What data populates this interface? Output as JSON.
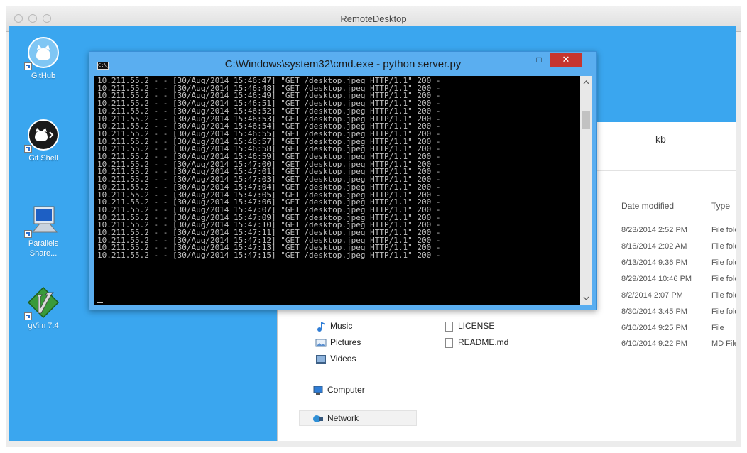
{
  "mac_window": {
    "title": "RemoteDesktop"
  },
  "desktop_icons": [
    {
      "label": "GitHub",
      "icon": "github-octocat-icon"
    },
    {
      "label": "Git Shell",
      "icon": "git-shell-icon"
    },
    {
      "label_line1": "Parallels",
      "label_line2": "Share...",
      "icon": "parallels-share-icon"
    },
    {
      "label": "gVim 7.4",
      "icon": "gvim-icon"
    }
  ],
  "cmd": {
    "title": "C:\\Windows\\system32\\cmd.exe - python  server.py",
    "minimize": "–",
    "maximize": "□",
    "close": "✕",
    "sys_icon_text": "C:\\_",
    "lines": [
      "10.211.55.2 - - [30/Aug/2014 15:46:47] \"GET /desktop.jpeg HTTP/1.1\" 200 -",
      "10.211.55.2 - - [30/Aug/2014 15:46:48] \"GET /desktop.jpeg HTTP/1.1\" 200 -",
      "10.211.55.2 - - [30/Aug/2014 15:46:49] \"GET /desktop.jpeg HTTP/1.1\" 200 -",
      "10.211.55.2 - - [30/Aug/2014 15:46:51] \"GET /desktop.jpeg HTTP/1.1\" 200 -",
      "10.211.55.2 - - [30/Aug/2014 15:46:52] \"GET /desktop.jpeg HTTP/1.1\" 200 -",
      "10.211.55.2 - - [30/Aug/2014 15:46:53] \"GET /desktop.jpeg HTTP/1.1\" 200 -",
      "10.211.55.2 - - [30/Aug/2014 15:46:54] \"GET /desktop.jpeg HTTP/1.1\" 200 -",
      "10.211.55.2 - - [30/Aug/2014 15:46:55] \"GET /desktop.jpeg HTTP/1.1\" 200 -",
      "10.211.55.2 - - [30/Aug/2014 15:46:57] \"GET /desktop.jpeg HTTP/1.1\" 200 -",
      "10.211.55.2 - - [30/Aug/2014 15:46:58] \"GET /desktop.jpeg HTTP/1.1\" 200 -",
      "10.211.55.2 - - [30/Aug/2014 15:46:59] \"GET /desktop.jpeg HTTP/1.1\" 200 -",
      "10.211.55.2 - - [30/Aug/2014 15:47:00] \"GET /desktop.jpeg HTTP/1.1\" 200 -",
      "10.211.55.2 - - [30/Aug/2014 15:47:01] \"GET /desktop.jpeg HTTP/1.1\" 200 -",
      "10.211.55.2 - - [30/Aug/2014 15:47:03] \"GET /desktop.jpeg HTTP/1.1\" 200 -",
      "10.211.55.2 - - [30/Aug/2014 15:47:04] \"GET /desktop.jpeg HTTP/1.1\" 200 -",
      "10.211.55.2 - - [30/Aug/2014 15:47:05] \"GET /desktop.jpeg HTTP/1.1\" 200 -",
      "10.211.55.2 - - [30/Aug/2014 15:47:06] \"GET /desktop.jpeg HTTP/1.1\" 200 -",
      "10.211.55.2 - - [30/Aug/2014 15:47:07] \"GET /desktop.jpeg HTTP/1.1\" 200 -",
      "10.211.55.2 - - [30/Aug/2014 15:47:09] \"GET /desktop.jpeg HTTP/1.1\" 200 -",
      "10.211.55.2 - - [30/Aug/2014 15:47:10] \"GET /desktop.jpeg HTTP/1.1\" 200 -",
      "10.211.55.2 - - [30/Aug/2014 15:47:11] \"GET /desktop.jpeg HTTP/1.1\" 200 -",
      "10.211.55.2 - - [30/Aug/2014 15:47:12] \"GET /desktop.jpeg HTTP/1.1\" 200 -",
      "10.211.55.2 - - [30/Aug/2014 15:47:13] \"GET /desktop.jpeg HTTP/1.1\" 200 -",
      "10.211.55.2 - - [30/Aug/2014 15:47:15] \"GET /desktop.jpeg HTTP/1.1\" 200 -"
    ]
  },
  "explorer": {
    "title": "kb",
    "columns": {
      "date_modified": "Date modified",
      "type": "Type"
    },
    "rows": [
      {
        "date": "8/23/2014 2:52 PM",
        "type": "File folde"
      },
      {
        "date": "8/16/2014 2:02 AM",
        "type": "File folde"
      },
      {
        "date": "6/13/2014 9:36 PM",
        "type": "File folde"
      },
      {
        "date": "8/29/2014 10:46 PM",
        "type": "File folde"
      },
      {
        "date": "8/2/2014 2:07 PM",
        "type": "File folde"
      },
      {
        "date": "8/30/2014 3:45 PM",
        "type": "File folde"
      },
      {
        "date": "6/10/2014 9:25 PM",
        "type": "File"
      },
      {
        "date": "6/10/2014 9:22 PM",
        "type": "MD File"
      }
    ],
    "files": [
      "LICENSE",
      "README.md"
    ],
    "nav": {
      "music": "Music",
      "pictures": "Pictures",
      "videos": "Videos",
      "computer": "Computer",
      "network": "Network"
    }
  },
  "colors": {
    "desktop": "#3aa6ef",
    "cmd_frame": "#5aaef0",
    "close_button": "#c7352e"
  }
}
